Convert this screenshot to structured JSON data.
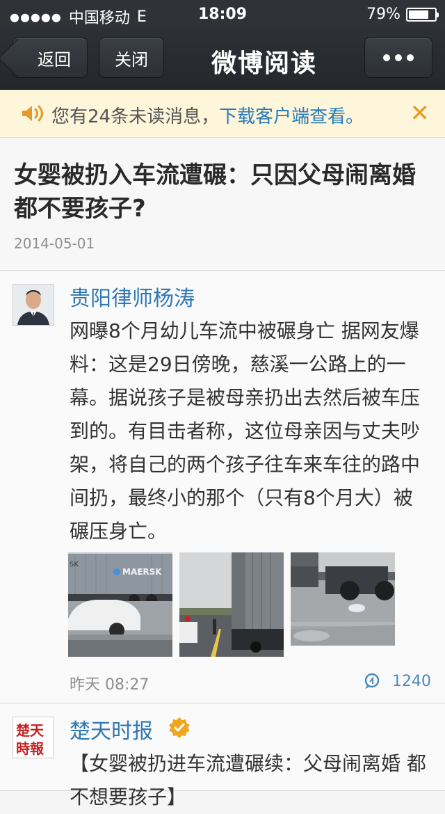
{
  "status_bar": {
    "signal_dots": "●●●●●",
    "carrier": "中国移动",
    "network": "E",
    "time": "18:09",
    "battery_pct_label": "79%",
    "battery_level": 0.79
  },
  "nav": {
    "back_label": "返回",
    "close_label": "关闭",
    "title": "微博阅读",
    "more_icon": "more-dots-icon"
  },
  "notice": {
    "prefix": "您有24条未读消息，",
    "link": "下载客户端查看。",
    "close_glyph": "✕",
    "accent": "#e49a2a"
  },
  "article": {
    "title": "女婴被扔入车流遭碾：只因父母闹离婚都不要孩子?",
    "date": "2014-05-01"
  },
  "posts": [
    {
      "author": "贵阳律师杨涛",
      "text": "网曝8个月幼儿车流中被碾身亡 据网友爆料：这是29日傍晚，慈溪一公路上的一幕。据说孩子是被母亲扔出去然后被车压到的。有目击者称，这位母亲因与丈夫吵架，将自己的两个孩子往车来车往的路中间扔，最终小的那个（只有8个月大）被碾压身亡。",
      "time": "昨天 08:27",
      "comment_count": "1240",
      "thumb_text": "MAERSK",
      "thumb_text_partial": "SK"
    },
    {
      "author": "楚天时报",
      "avatar_text": "楚天時報",
      "verified_icon": "verified-badge-icon",
      "text": "【女婴被扔进车流遭碾续：父母闹离婚 都不想要孩子】"
    }
  ],
  "colors": {
    "nav_bg": "#2d3136",
    "link_blue": "#2f78b5",
    "notice_bg": "#fdf6da"
  }
}
